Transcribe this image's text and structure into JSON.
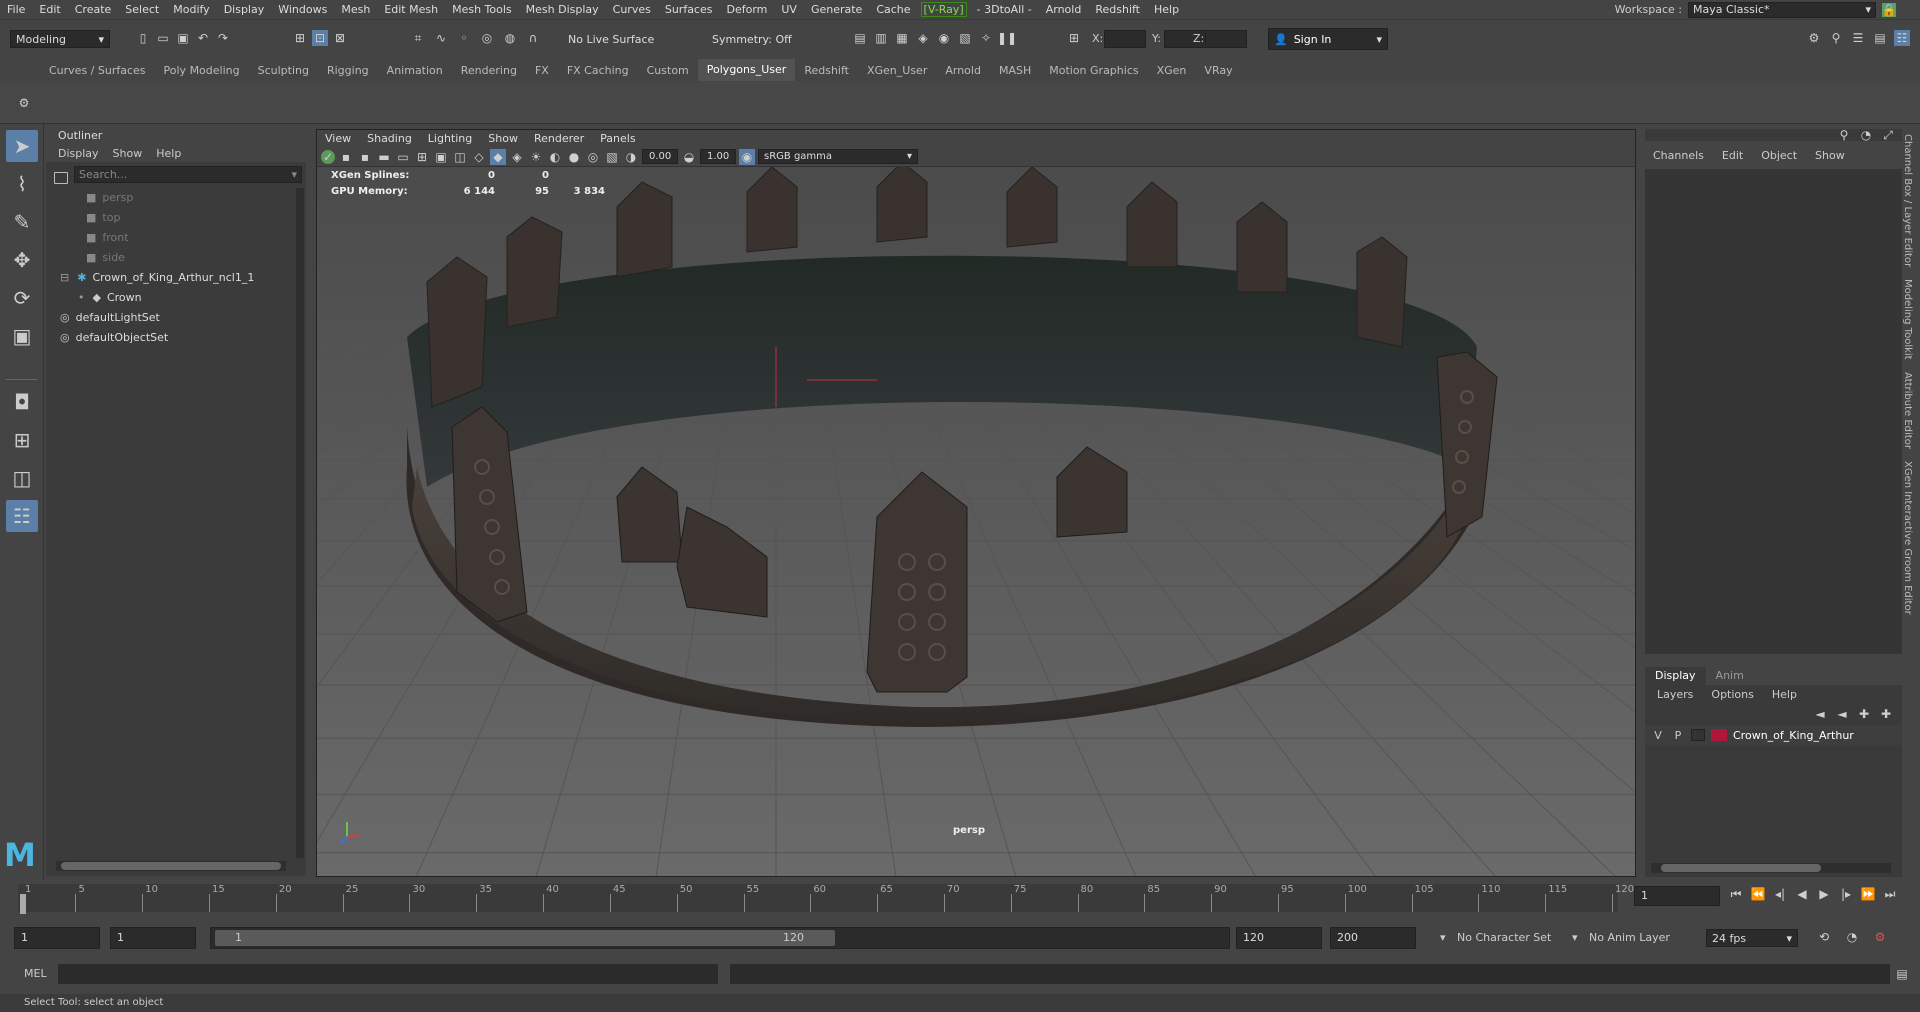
{
  "menubar": {
    "items": [
      "File",
      "Edit",
      "Create",
      "Select",
      "Modify",
      "Display",
      "Windows",
      "Mesh",
      "Edit Mesh",
      "Mesh Tools",
      "Mesh Display",
      "Curves",
      "Surfaces",
      "Deform",
      "UV",
      "Generate",
      "Cache",
      "[V-Ray]",
      "- 3DtoAll -",
      "Arnold",
      "Redshift",
      "Help"
    ],
    "workspace_label": "Workspace :",
    "workspace_value": "Maya Classic*"
  },
  "statusline": {
    "mode": "Modeling",
    "live_surface": "No Live Surface",
    "symmetry": "Symmetry: Off",
    "x_label": "X:",
    "y_label": "Y:",
    "z_label": "Z:",
    "sign_in": "Sign In"
  },
  "shelf_tabs": [
    "Curves / Surfaces",
    "Poly Modeling",
    "Sculpting",
    "Rigging",
    "Animation",
    "Rendering",
    "FX",
    "FX Caching",
    "Custom",
    "Polygons_User",
    "Redshift",
    "XGen_User",
    "Arnold",
    "MASH",
    "Motion Graphics",
    "XGen",
    "VRay"
  ],
  "shelf_active": "Polygons_User",
  "outliner": {
    "title": "Outliner",
    "menus": [
      "Display",
      "Show",
      "Help"
    ],
    "search_placeholder": "Search...",
    "items": [
      {
        "label": "persp",
        "dim": true
      },
      {
        "label": "top",
        "dim": true
      },
      {
        "label": "front",
        "dim": true
      },
      {
        "label": "side",
        "dim": true
      },
      {
        "label": "Crown_of_King_Arthur_ncl1_1",
        "dim": false
      },
      {
        "label": "Crown",
        "dim": false
      },
      {
        "label": "defaultLightSet",
        "dim": false
      },
      {
        "label": "defaultObjectSet",
        "dim": false
      }
    ]
  },
  "viewport": {
    "menus": [
      "View",
      "Shading",
      "Lighting",
      "Show",
      "Renderer",
      "Panels"
    ],
    "exposure": "0.00",
    "gamma": "1.00",
    "colorspace": "sRGB gamma",
    "camera": "persp",
    "stats": [
      {
        "label": "XGen Splines:",
        "a": "0",
        "b": "0",
        "c": ""
      },
      {
        "label": "GPU Memory:",
        "a": "6 144",
        "b": "95",
        "c": "3 834"
      }
    ]
  },
  "channel_box": {
    "menus": [
      "Channels",
      "Edit",
      "Object",
      "Show"
    ]
  },
  "layer_editor": {
    "tabs": [
      "Display",
      "Anim"
    ],
    "menus": [
      "Layers",
      "Options",
      "Help"
    ],
    "layer": {
      "v": "V",
      "p": "P",
      "name": "Crown_of_King_Arthur",
      "color": "#b0153a"
    }
  },
  "side_tabs": [
    "Channel Box / Layer Editor",
    "Modeling Toolkit",
    "Attribute Editor",
    "XGen Interactive Groom Editor"
  ],
  "timeline": {
    "ticks": [
      "1",
      "5",
      "10",
      "15",
      "20",
      "25",
      "30",
      "35",
      "40",
      "45",
      "50",
      "55",
      "60",
      "65",
      "70",
      "75",
      "80",
      "85",
      "90",
      "95",
      "100",
      "105",
      "110",
      "115",
      "120"
    ],
    "current_frame": "1"
  },
  "range": {
    "start": "1",
    "inner_start": "1",
    "slider_start": "1",
    "slider_end": "120",
    "end": "120",
    "anim_end": "200",
    "character_set": "No Character Set",
    "anim_layer": "No Anim Layer",
    "fps": "24 fps"
  },
  "mel": {
    "label": "MEL"
  },
  "help_line": "Select Tool: select an object"
}
